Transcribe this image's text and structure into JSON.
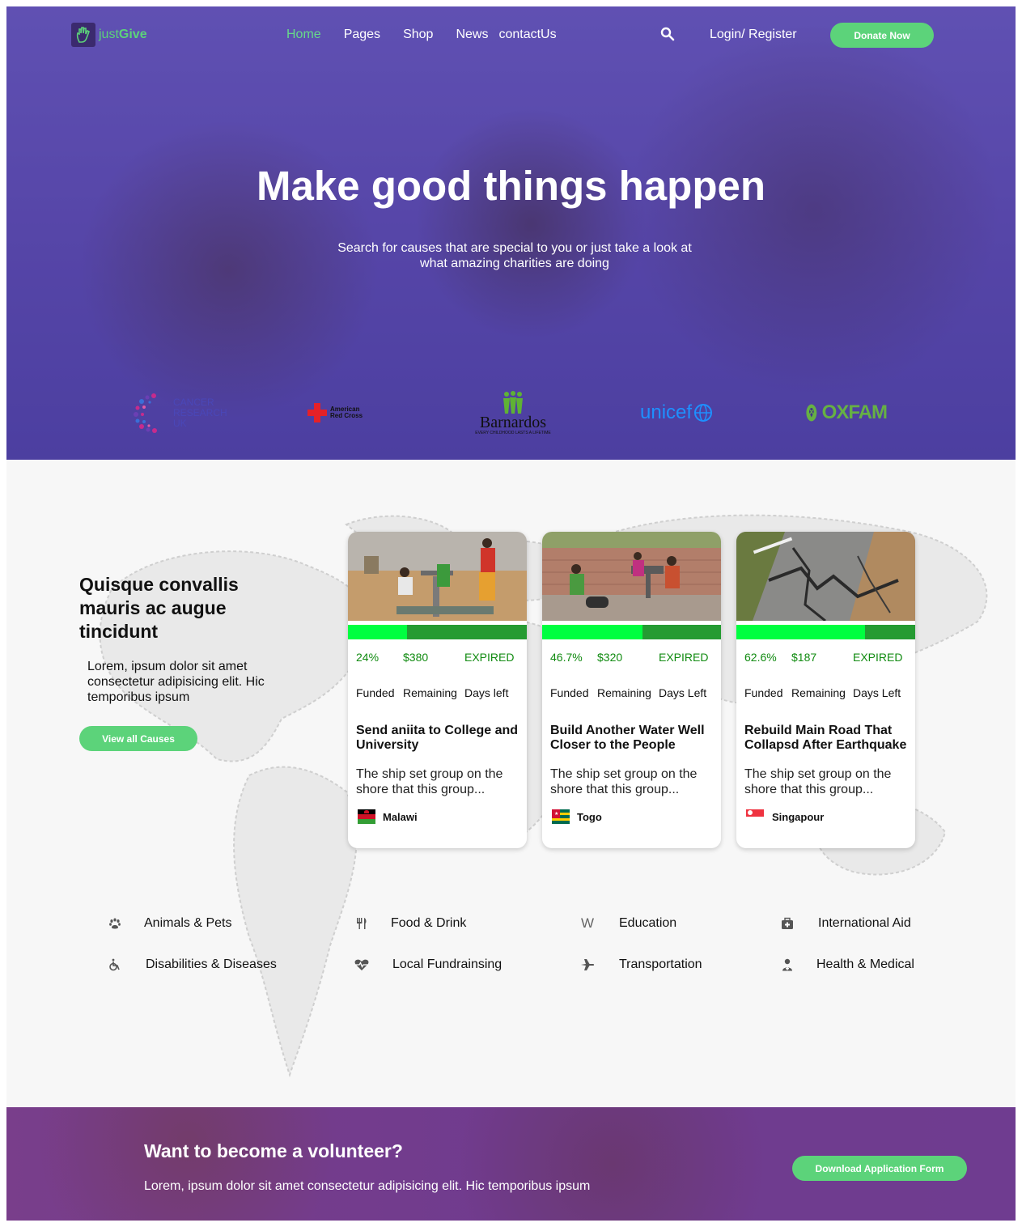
{
  "header": {
    "logo": {
      "text_a": "just",
      "text_b": "Give"
    },
    "nav": [
      "Home",
      "Pages",
      "Shop",
      "News",
      "contactUs"
    ],
    "login": "Login/ Register",
    "donate": "Donate Now"
  },
  "hero": {
    "title": "Make good things happen",
    "subtitle": "Search for causes that are special to you or just take a look at what amazing charities are doing",
    "partners": {
      "cancer": [
        "CANCER",
        "RESEARCH",
        "UK"
      ],
      "redcross": [
        "American",
        "Red Cross"
      ],
      "barnardos": {
        "name": "Barnardos",
        "tagline": "EVERY CHILDHOOD LASTS A LIFETIME"
      },
      "unicef": "unicef",
      "oxfam": "OXFAM"
    }
  },
  "causes_intro": {
    "heading": "Quisque convallis mauris ac augue tincidunt",
    "text": "Lorem, ipsum dolor sit amet consectetur adipisicing elit. Hic temporibus ipsum",
    "button": "View all Causes"
  },
  "stat_labels": {
    "funded": "Funded",
    "remaining": "Remaining",
    "days": "Days left",
    "days_alt": "Days Left"
  },
  "cards": [
    {
      "percent": "24%",
      "progress": 0.33,
      "amount": "$380",
      "status": "EXPIRED",
      "title": "Send aniita to College and University",
      "desc": "The ship set group on the shore that this group...",
      "location": "Malawi"
    },
    {
      "percent": "46.7%",
      "progress": 0.56,
      "amount": "$320",
      "status": "EXPIRED",
      "title": "Build Another Water Well Closer to the People",
      "desc": "The ship set group on the shore that this group...",
      "location": "Togo"
    },
    {
      "percent": "62.6%",
      "progress": 0.72,
      "amount": "$187",
      "status": "EXPIRED",
      "title": "Rebuild Main Road That Collapsd After Earthquake",
      "desc": "The ship set group on the shore that this group...",
      "location": "Singapour"
    }
  ],
  "categories": [
    {
      "label": "Animals & Pets",
      "icon": "paw-icon"
    },
    {
      "label": "Food & Drink",
      "icon": "utensils-icon"
    },
    {
      "label": "Education",
      "icon": "education-icon"
    },
    {
      "label": "International Aid",
      "icon": "medkit-icon"
    },
    {
      "label": "Disabilities & Diseases",
      "icon": "wheelchair-icon"
    },
    {
      "label": "Local Fundrainsing",
      "icon": "heartbeat-icon"
    },
    {
      "label": "Transportation",
      "icon": "plane-icon"
    },
    {
      "label": "Health & Medical",
      "icon": "doctor-icon"
    }
  ],
  "volunteer": {
    "title": "Want to become a volunteer?",
    "text": "Lorem, ipsum dolor sit amet consectetur adipisicing elit. Hic temporibus ipsum",
    "button": "Download Application Form"
  },
  "colors": {
    "accent": "#5cd37a",
    "progress_fill": "#00ff40",
    "progress_track": "#259b32",
    "stat_green": "#118b11"
  }
}
